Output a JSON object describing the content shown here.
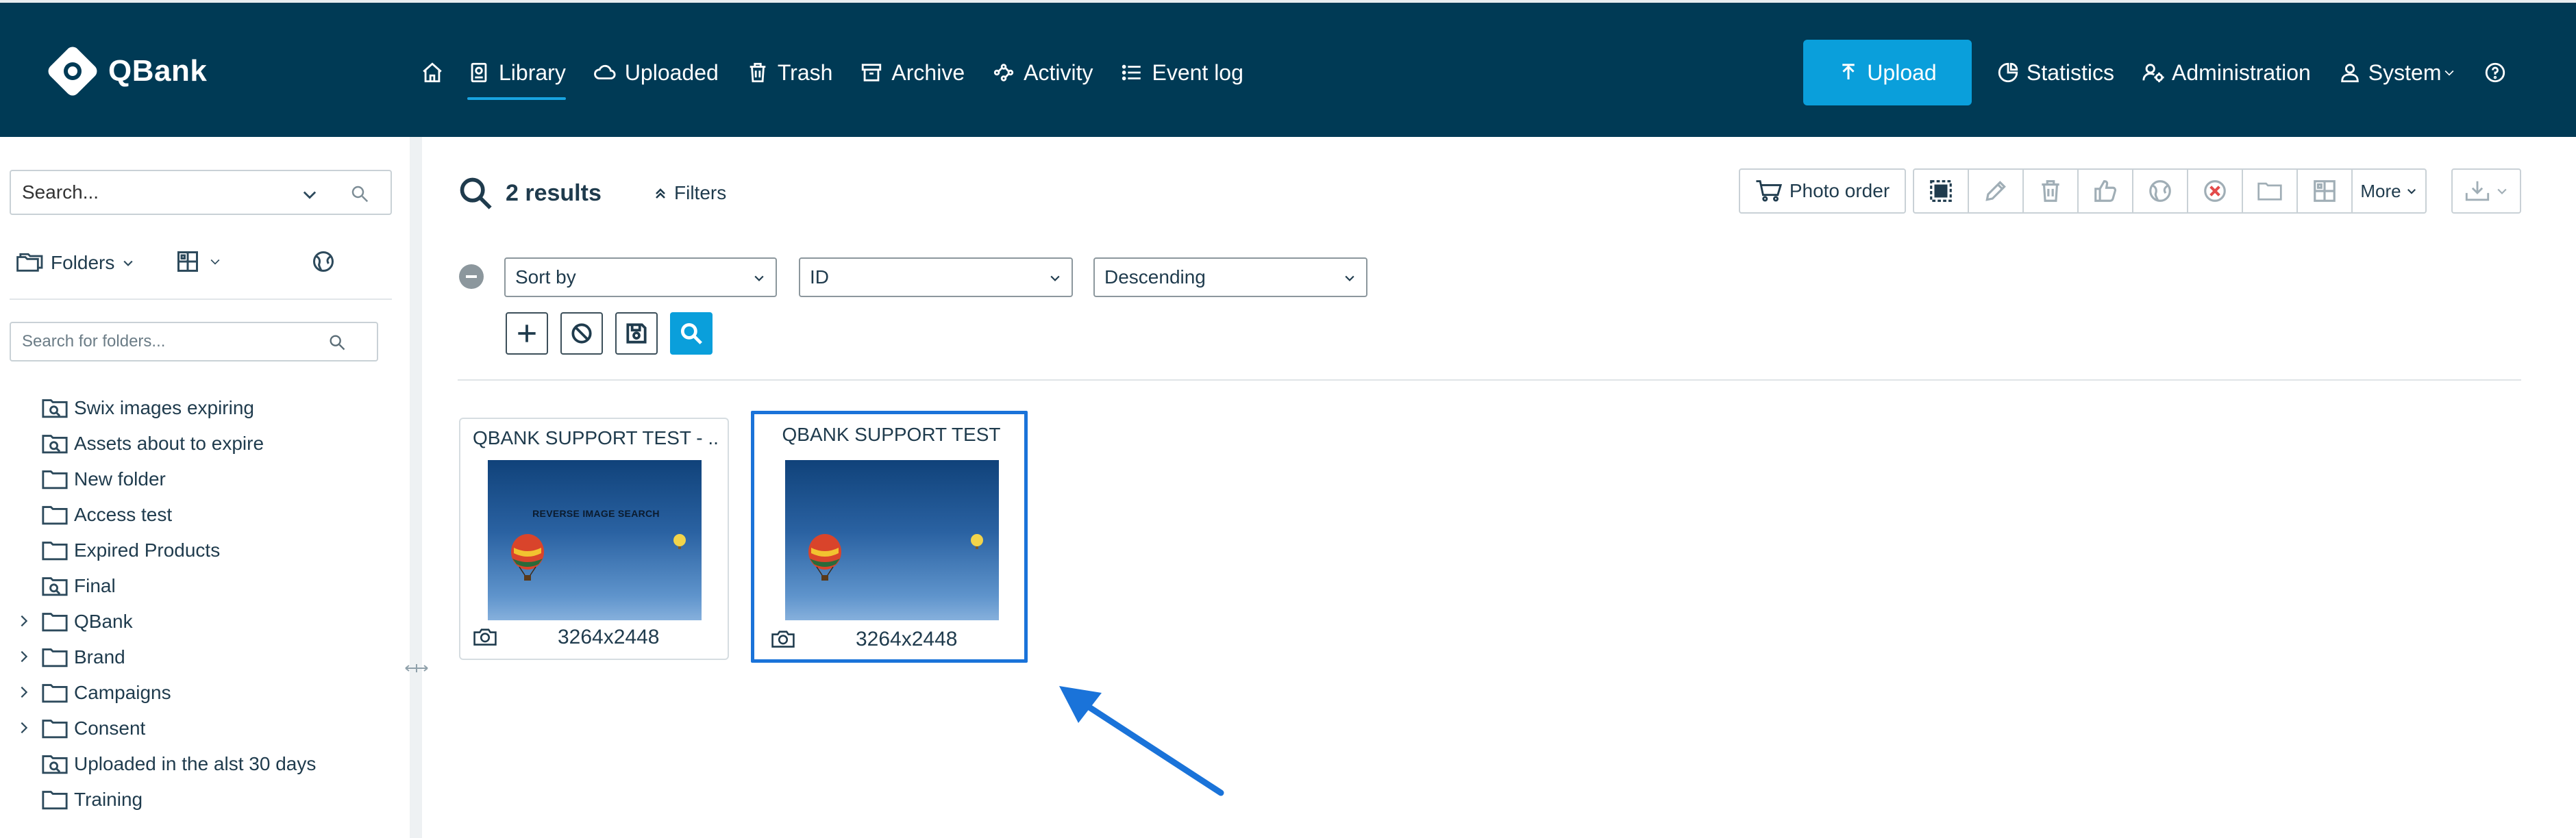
{
  "app": {
    "name": "QBank"
  },
  "nav": {
    "items": [
      {
        "id": "library",
        "label": "Library",
        "icon": "library-icon",
        "active": true
      },
      {
        "id": "uploaded",
        "label": "Uploaded",
        "icon": "cloud-icon"
      },
      {
        "id": "trash",
        "label": "Trash",
        "icon": "trash-icon"
      },
      {
        "id": "archive",
        "label": "Archive",
        "icon": "archive-icon"
      },
      {
        "id": "activity",
        "label": "Activity",
        "icon": "activity-icon"
      },
      {
        "id": "eventlog",
        "label": "Event log",
        "icon": "list-icon"
      }
    ],
    "upload_label": "Upload",
    "statistics_label": "Statistics",
    "administration_label": "Administration",
    "system_label": "System"
  },
  "sidebar": {
    "search_placeholder": "Search...",
    "folders_label": "Folders",
    "folder_search_placeholder": "Search for folders...",
    "tree": [
      {
        "label": "Swix images expiring",
        "type": "smart-folder",
        "expandable": false
      },
      {
        "label": "Assets about to expire",
        "type": "smart-folder",
        "expandable": false
      },
      {
        "label": "New folder",
        "type": "folder",
        "expandable": false
      },
      {
        "label": "Access test",
        "type": "folder",
        "expandable": false
      },
      {
        "label": "Expired Products",
        "type": "folder",
        "expandable": false
      },
      {
        "label": "Final",
        "type": "smart-folder",
        "expandable": false
      },
      {
        "label": "QBank",
        "type": "folder",
        "expandable": true
      },
      {
        "label": "Brand",
        "type": "folder",
        "expandable": true
      },
      {
        "label": "Campaigns",
        "type": "folder",
        "expandable": true
      },
      {
        "label": "Consent",
        "type": "folder",
        "expandable": true
      },
      {
        "label": "Uploaded in the alst 30 days",
        "type": "smart-folder",
        "expandable": false
      },
      {
        "label": "Training",
        "type": "folder",
        "expandable": false
      }
    ]
  },
  "main": {
    "results_label": "2 results",
    "filters_label": "Filters",
    "photo_order_label": "Photo order",
    "more_label": "More",
    "sort": {
      "sort_by": "Sort by",
      "field": "ID",
      "direction": "Descending"
    },
    "cards": [
      {
        "title": "QBANK SUPPORT TEST - ...",
        "dimensions": "3264x2448",
        "overlay_text": "REVERSE IMAGE SEARCH",
        "selected": false
      },
      {
        "title": "QBANK SUPPORT TEST",
        "dimensions": "3264x2448",
        "overlay_text": "",
        "selected": true
      }
    ]
  },
  "colors": {
    "header_bg": "#003a55",
    "accent": "#0a9fdb",
    "selection": "#1a73d9",
    "annotation_arrow": "#1a73d9"
  }
}
